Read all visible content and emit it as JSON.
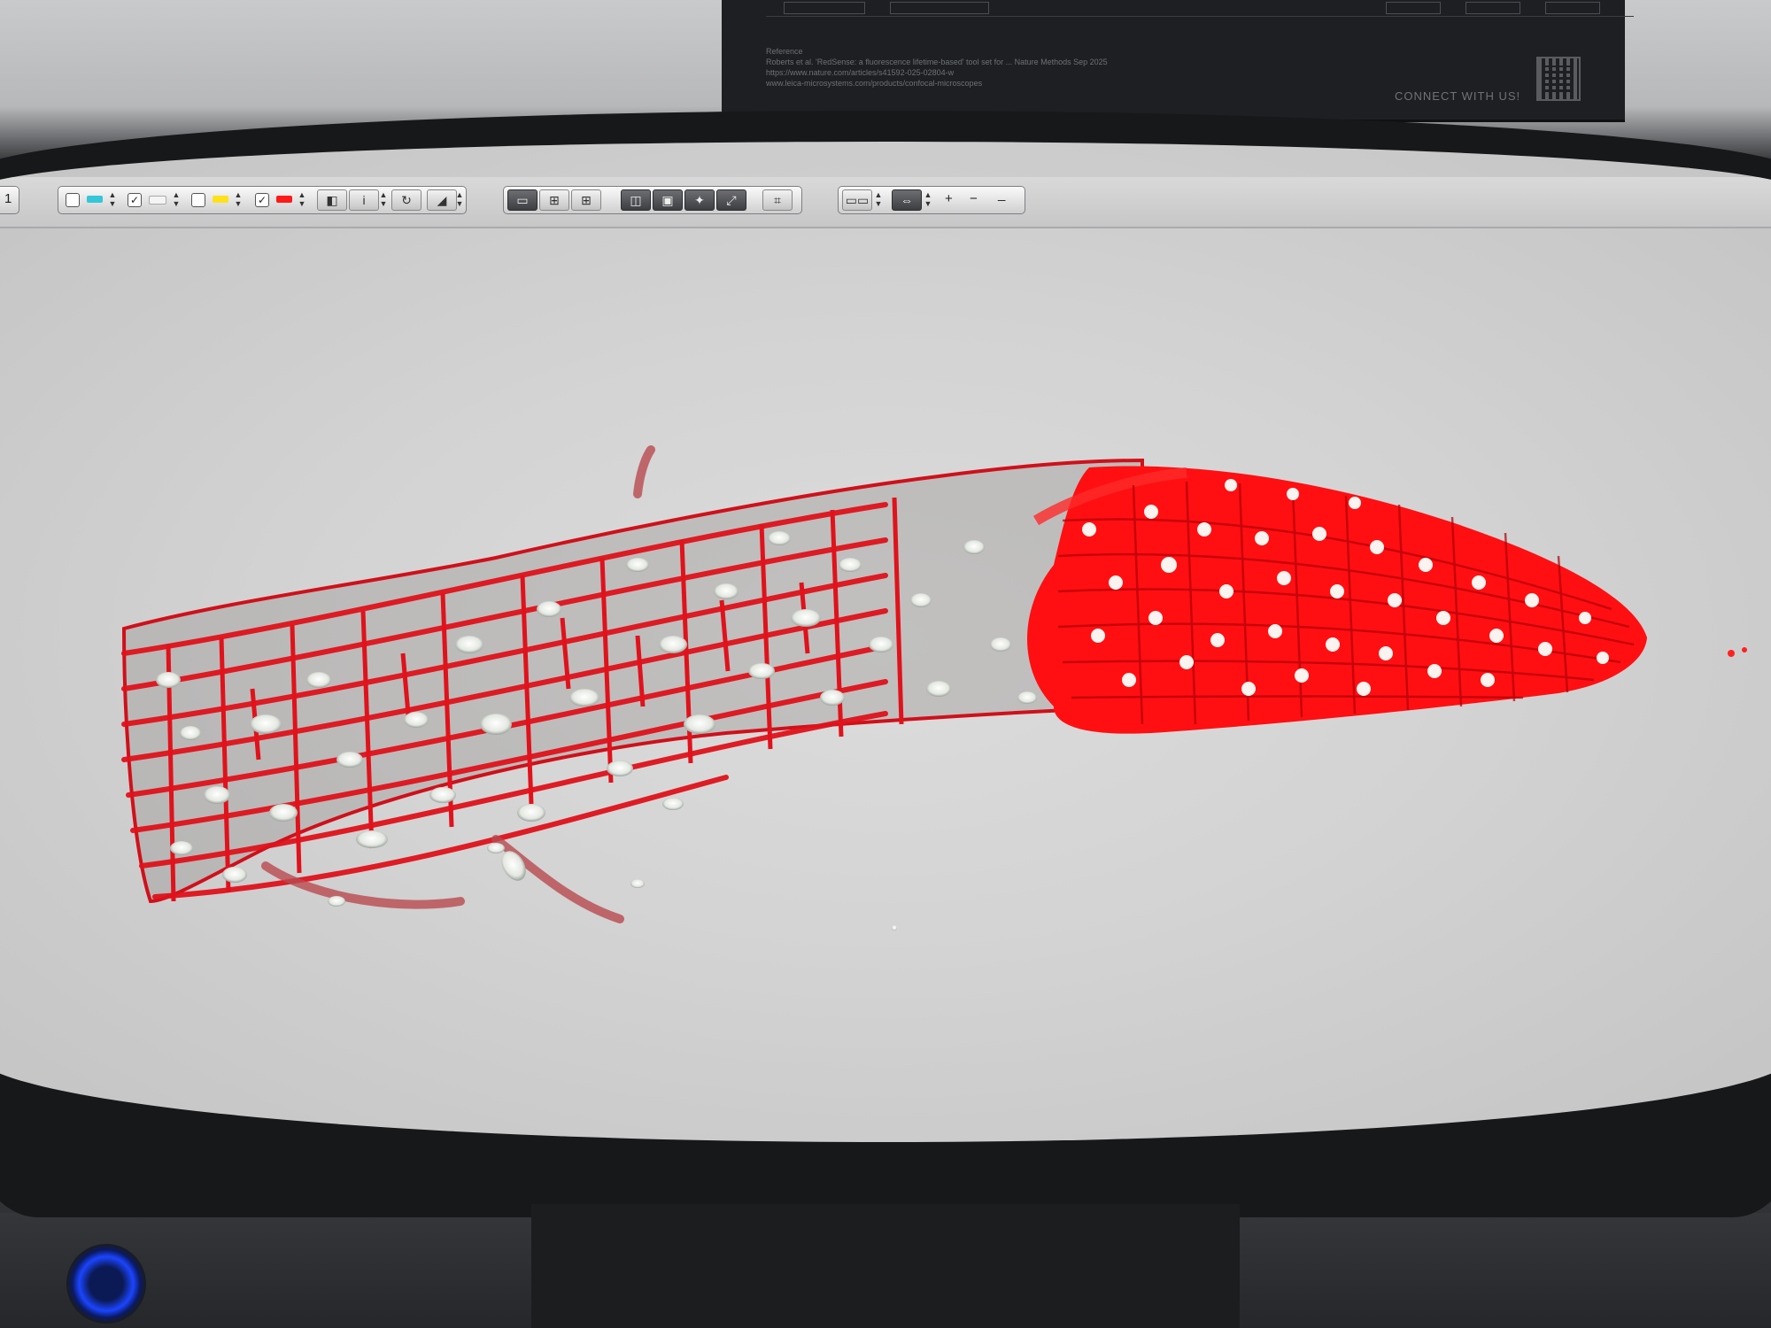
{
  "poster": {
    "reference_heading": "Reference",
    "reference_line1": "Roberts et al. 'RedSense: a fluorescence lifetime-based' tool set for ... Nature Methods Sep 2025",
    "reference_line2": "https://www.nature.com/articles/s41592-025-02804-w",
    "reference_line3": "www.leica-microsystems.com/products/confocal-microscopes",
    "connect": "CONNECT WITH US!"
  },
  "toolbar": {
    "prefix_label": "1",
    "channels": [
      {
        "color": "#33c7d8",
        "checked": false
      },
      {
        "color": "#f4f4f4",
        "checked": true
      },
      {
        "color": "#ffe11a",
        "checked": false
      },
      {
        "color": "#ff1a1a",
        "checked": true
      }
    ],
    "plus_label": "+",
    "minus_label": "−",
    "min_label": "_"
  },
  "colors": {
    "cell_wall": "#e0121b",
    "tip_fill": "#ff0f12",
    "nucleus": "#e9ece6",
    "background": "#d4d4d4"
  }
}
